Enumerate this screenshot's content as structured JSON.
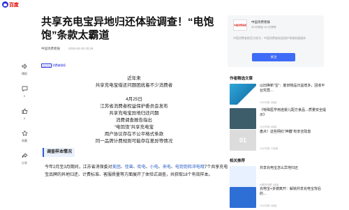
{
  "logo": {
    "baidu": "Bai",
    "hao": "百度",
    "alt": "百度"
  },
  "article": {
    "title": "共享充电宝异地归还体验调查！“电饱饱”条款太霸道",
    "source": "中国消费者报",
    "date": "2025-04-25 20:26",
    "badge_a": "CCTV",
    "badge_b": "消费者维权",
    "lines": [
      "近年来",
      "共享充电宝借还问题困扰着不少消费者",
      "",
      "4月25日",
      "江苏省消费者权益保护委员会发布",
      "共享充电宝异地归还问题",
      "消费调查报告指出",
      "“电饱饱”共享充电宝",
      "用户协议存在不公平格式条款",
      "同一品牌计费规则可能存在差异等情况"
    ],
    "tag": "调查样本情况",
    "para": {
      "p1": "今年2月至3月期间，江苏省消保委对",
      "brands": [
        "美团",
        "怪兽",
        "街电",
        "小电",
        "来电",
        "电饱饱和",
        "冲电哦"
      ],
      "sep": "、",
      "p2": "7个共享充电宝品牌的异地归还、计费标准、客服质量等方面展开了体验式调查，共获取18个有效样本。"
    }
  },
  "side_actions": [
    {
      "icon": "speaker-icon",
      "label": "播报"
    },
    {
      "icon": "comment-icon",
      "label": "0"
    },
    {
      "icon": "like-icon",
      "label": "0"
    },
    {
      "icon": "star-icon",
      "label": "收藏"
    },
    {
      "icon": "share-icon",
      "label": "分享"
    }
  ],
  "author_card": {
    "avatar_text": "中国消费者报",
    "name": "中国消费者报",
    "stats": "26.3万粉丝  10.1万获赞",
    "desc": "中国消费者报官方账号，中国消费者权益保护领域权威媒体",
    "follow": "关注"
  },
  "recommend": {
    "title": "作者精选文章",
    "items": [
      {
        "title": "以旧换新“宝”：废旧物品日益增多，回收平台究竟…",
        "meta": "12小时前  1阅读"
      },
      {
        "title": "《特殊医学用途婴儿配方食品…质量安全提示》",
        "meta": "12小时前  4阅读"
      },
      {
        "title": "盘点！这些网红“神器”有安全隐患",
        "meta": "12小时前  17阅读"
      }
    ]
  },
  "related": {
    "title": "相关推荐",
    "items": [
      {
        "title": "共享充电宝怎么异地归还",
        "meta": "AI聊查专题  1阅读"
      },
      {
        "title": "充电宝+多镜离开：解锁共享充电宝背后的…",
        "meta": "12小时前  1阅读"
      }
    ]
  },
  "colors": {
    "accent": "#3f6cf6",
    "link": "#2b5fc6",
    "brand_red": "#e10601",
    "brand_blue": "#2932e1"
  }
}
